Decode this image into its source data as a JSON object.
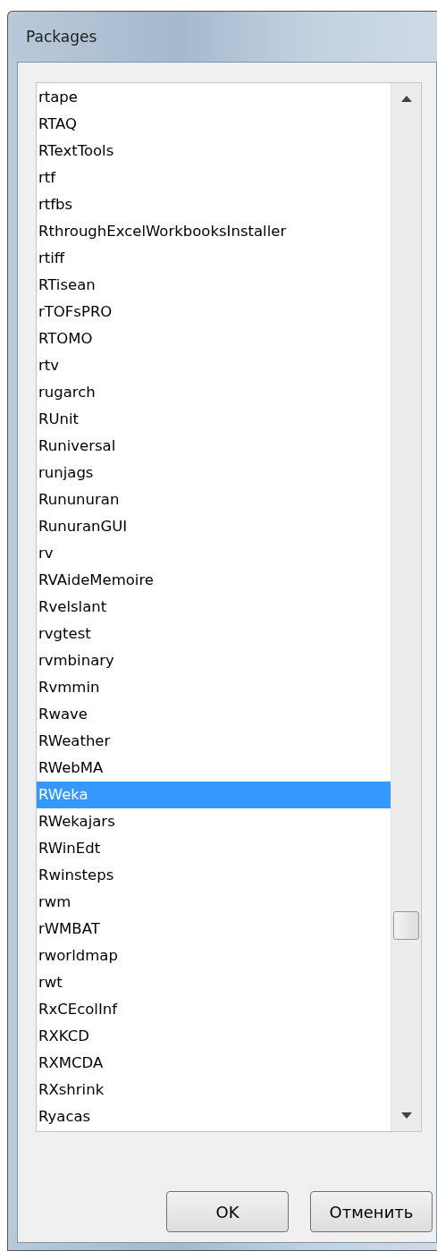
{
  "window": {
    "title": "Packages"
  },
  "packages": [
    {
      "label": "rtape",
      "selected": false
    },
    {
      "label": "RTAQ",
      "selected": false
    },
    {
      "label": "RTextTools",
      "selected": false
    },
    {
      "label": "rtf",
      "selected": false
    },
    {
      "label": "rtfbs",
      "selected": false
    },
    {
      "label": "RthroughExcelWorkbooksInstaller",
      "selected": false
    },
    {
      "label": "rtiff",
      "selected": false
    },
    {
      "label": "RTisean",
      "selected": false
    },
    {
      "label": "rTOFsPRO",
      "selected": false
    },
    {
      "label": "RTOMO",
      "selected": false
    },
    {
      "label": "rtv",
      "selected": false
    },
    {
      "label": "rugarch",
      "selected": false
    },
    {
      "label": "RUnit",
      "selected": false
    },
    {
      "label": "Runiversal",
      "selected": false
    },
    {
      "label": "runjags",
      "selected": false
    },
    {
      "label": "Rununuran",
      "selected": false
    },
    {
      "label": "RunuranGUI",
      "selected": false
    },
    {
      "label": "rv",
      "selected": false
    },
    {
      "label": "RVAideMemoire",
      "selected": false
    },
    {
      "label": "Rvelslant",
      "selected": false
    },
    {
      "label": "rvgtest",
      "selected": false
    },
    {
      "label": "rvmbinary",
      "selected": false
    },
    {
      "label": "Rvmmin",
      "selected": false
    },
    {
      "label": "Rwave",
      "selected": false
    },
    {
      "label": "RWeather",
      "selected": false
    },
    {
      "label": "RWebMA",
      "selected": false
    },
    {
      "label": "RWeka",
      "selected": true
    },
    {
      "label": "RWekajars",
      "selected": false
    },
    {
      "label": "RWinEdt",
      "selected": false
    },
    {
      "label": "Rwinsteps",
      "selected": false
    },
    {
      "label": "rwm",
      "selected": false
    },
    {
      "label": "rWMBAT",
      "selected": false
    },
    {
      "label": "rworldmap",
      "selected": false
    },
    {
      "label": "rwt",
      "selected": false
    },
    {
      "label": "RxCEcolInf",
      "selected": false
    },
    {
      "label": "RXKCD",
      "selected": false
    },
    {
      "label": "RXMCDA",
      "selected": false
    },
    {
      "label": "RXshrink",
      "selected": false
    },
    {
      "label": "Ryacas",
      "selected": false
    }
  ],
  "buttons": [
    "OK",
    "Отменить"
  ]
}
